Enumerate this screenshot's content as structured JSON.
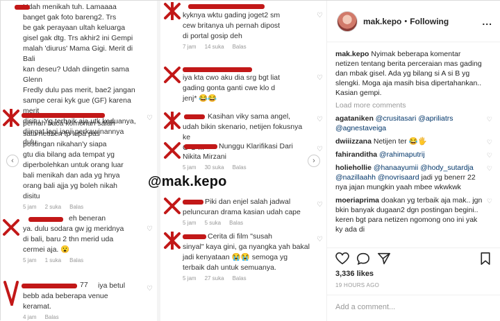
{
  "post": {
    "username": "mak.kepo",
    "follow_status": "Following",
    "more_label": "...",
    "caption": "Nyimak beberapa komentar netizen tentang berita perceraian mas gading dan mbak gisel. Ada yg bilang si A si B yg slengki. Moga aja masih bisa dipertahankan.. Kasian gempi.",
    "load_more": "Load more comments",
    "likes": "3,336 likes",
    "timestamp": "19 HOURS AGO",
    "add_comment_placeholder": "Add a comment...",
    "post_button": "Post"
  },
  "comments": [
    {
      "user": "agataniken",
      "mentions": "@crusitasari @apriliatrs @agnestaveiga"
    },
    {
      "user": "dwiiizzana",
      "text": "Netijen ter 😂🖐"
    },
    {
      "user": "fahiranditha",
      "mentions": "@rahimaputrij"
    },
    {
      "user": "holiehollie",
      "mentions": "@hanaayumii @hody_sutardja @nazillaahh @novrisaard",
      "text": "jadi yg benerr 22 nya jajan mungkin yaah mbee wkwkwk"
    },
    {
      "user": "moeriaprima",
      "text": "doakan yg terbaik aja mak.. jgn bkin banyak dugaan2 dgn postingan begini.. keren bgt para netizen ngomong ono ini yak ky ada di"
    }
  ],
  "screenshot": {
    "watermark": "@mak.kepo",
    "left_column": [
      {
        "text": "Udah menikah tuh. Lamaaaa\nbanget gak foto bareng2. Trs\nbe gak perayaan ultah keluarga\ngisel gak dtg. Trs akhir2 ini Gempi\nmalah 'diurus' Mama Gigi. Merit di Bali\nkan deseu? Udah diingetin sama Glenn\nFredly dulu pas merit, bae2 jangan\nsampe cerai kyk gue (GF) karena merit\ndisitu. Yg terbaik aja utk keduanya,\ndiingat lagi janji perkawinannya dulu.",
        "meta": []
      },
      {
        "text": "pernah baca komenan salah\nsatu netizen tp lupa pas\npostingan nikahan'y siapa\ngtu dia bilang ada tempat yg\ndiperbolehkan untuk orang luar\nbali menikah dan ada yg hnya\norang bali ajja yg boleh nikah\ndisitu",
        "meta": [
          "5 jam",
          "2 suka",
          "Balas"
        ]
      },
      {
        "text": "ya. dulu sodara gw jg meridnya\ndi bali, baru 2 thn merid uda\ncermei aja. 😮",
        "meta": [
          "5 jam",
          "1 suka",
          "Balas"
        ]
      },
      {
        "text": "iya betul\nbebb ada beberapa venue\nkeramat.",
        "meta": [
          "4 jam",
          "Balas"
        ]
      }
    ],
    "left_column_fragments": [
      "eh beneran",
      "77"
    ],
    "right_column": [
      {
        "text": "kyknya wktu gading joget2 sm\ncew britanya uh pernah dipost\ndi portal gosip deh",
        "meta": [
          "7 jam",
          "14 suka",
          "Balas"
        ]
      },
      {
        "text": "iya kta cwo aku dia srg bgt liat\ngading gonta ganti cwe klo d\njenj* 😂😂",
        "meta": [
          "5 jam",
          "5 suka",
          "Balas"
        ]
      },
      {
        "text": "Kasihan viky sama angel,\nudah bikin skenario, netijen fokusnya ke\nG G ...",
        "meta": []
      },
      {
        "text": "Nunggu Klarifikasi Dari\nNikita Mirzani",
        "meta": [
          "5 jam",
          "30 suka",
          "Balas"
        ]
      },
      {
        "text": "Piki dan enjel salah jadwal\npeluncuran drama kasian udah cape",
        "meta": [
          "5 jam",
          "5 suka",
          "Balas"
        ]
      },
      {
        "text": "Cerita di film \"susah\nsinyal\" kaya gini, ga nyangka yah bakal\njadi kenyataan 😭😭 semoga yg\nterbaik dah untuk semuanya.",
        "meta": [
          "5 jam",
          "27 suka",
          "Balas"
        ]
      }
    ]
  },
  "colors": {
    "redact": "#c21818",
    "link": "#003569",
    "muted": "#999999"
  }
}
